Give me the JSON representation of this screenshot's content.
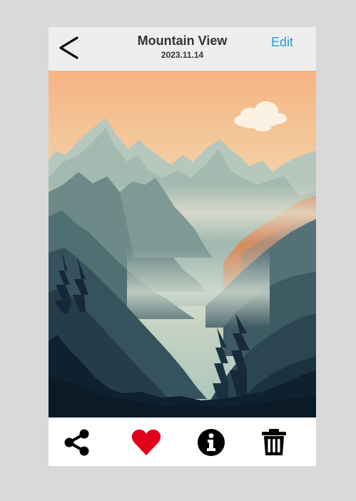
{
  "header": {
    "title": "Mountain View",
    "date": "2023.11.14",
    "edit_label": "Edit",
    "back_icon": "chevron-left-icon"
  },
  "photo": {
    "subject": "misty mountain range landscape at sunset"
  },
  "toolbar": {
    "items": [
      {
        "name": "share",
        "icon": "share-icon"
      },
      {
        "name": "favorite",
        "icon": "heart-icon",
        "color": "#e0001b"
      },
      {
        "name": "info",
        "icon": "info-icon"
      },
      {
        "name": "delete",
        "icon": "trash-icon"
      }
    ]
  },
  "colors": {
    "background": "#d9d9d9",
    "header_bg": "#eeeeee",
    "accent": "#2a9fd6",
    "heart": "#e0001b"
  }
}
